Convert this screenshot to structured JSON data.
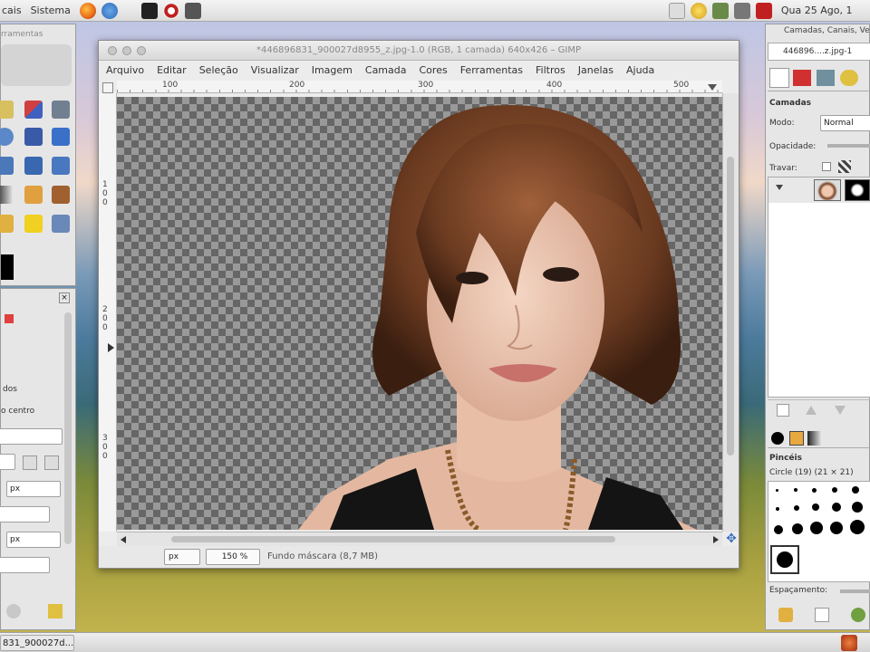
{
  "taskbar_top": {
    "menus": [
      "cais",
      "Sistema"
    ],
    "clock": "Qua 25 Ago, 1"
  },
  "taskbar_bottom": {
    "window_button": "831_900027d..."
  },
  "toolbox": {
    "title": "rramentas",
    "options": {
      "label_ados": "dos",
      "label_centro": "o centro",
      "unit_1": "px",
      "unit_2": "px"
    }
  },
  "gimp": {
    "title": "*446896831_900027d8955_z.jpg-1.0 (RGB, 1 camada) 640x426 – GIMP",
    "menus": [
      "Arquivo",
      "Editar",
      "Seleção",
      "Visualizar",
      "Imagem",
      "Camada",
      "Cores",
      "Ferramentas",
      "Filtros",
      "Janelas",
      "Ajuda"
    ],
    "ruler_h": [
      "100",
      "200",
      "300",
      "400",
      "500"
    ],
    "ruler_v": [
      "1\n0\n0",
      "2\n0\n0",
      "3\n0\n0"
    ],
    "status": {
      "unit": "px",
      "zoom": "150 %",
      "message": "Fundo máscara (8,7 MB)"
    }
  },
  "dock": {
    "title": "Camadas, Canais, Ve",
    "image_name": "446896....z.jpg-1",
    "layers_heading": "Camadas",
    "mode_label": "Modo:",
    "mode_value": "Normal",
    "opacity_label": "Opacidade:",
    "lock_label": "Travar:",
    "brushes_heading": "Pincéis",
    "brush_name": "Circle (19) (21 × 21)",
    "spacing_label": "Espaçamento:"
  },
  "colors": {
    "accent_fire": "#e86a1a",
    "hair": "#7a4426",
    "skin": "#e8c0a8"
  }
}
